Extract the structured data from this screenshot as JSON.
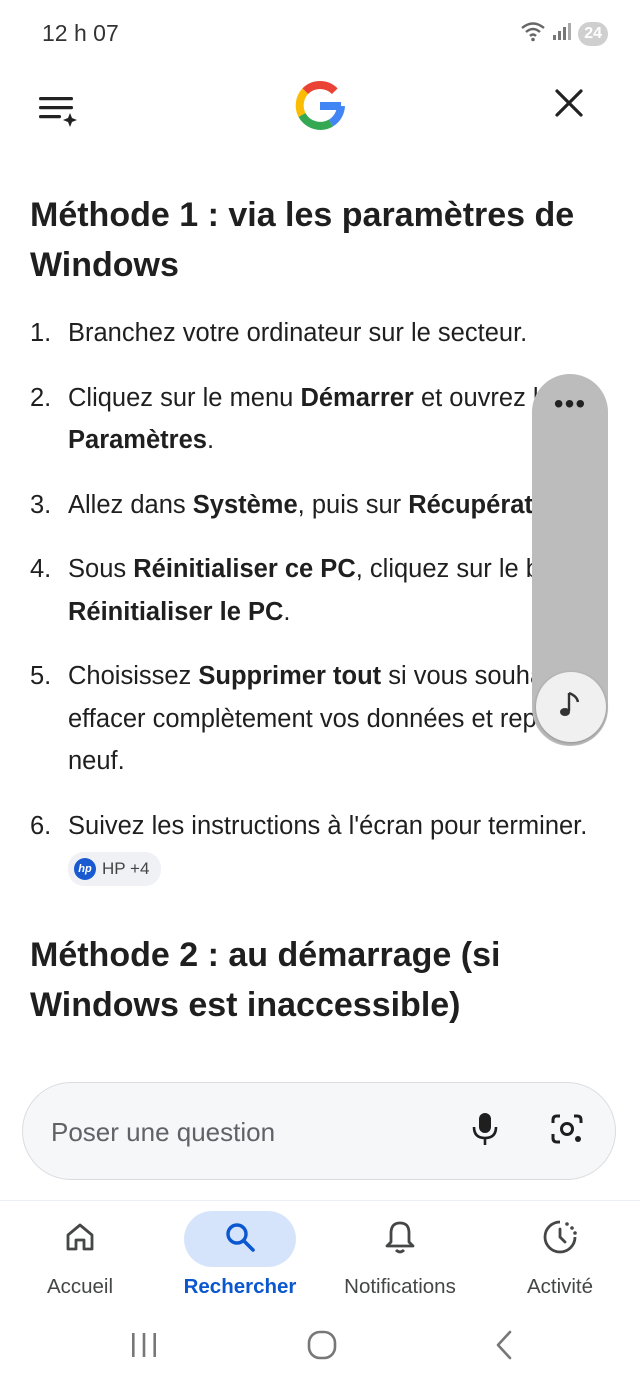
{
  "status_bar": {
    "time": "12 h 07",
    "battery_level": "24"
  },
  "header": {
    "menu_icon": "menu-sparkle-icon",
    "logo": "google-g-logo",
    "close_icon": "close-icon"
  },
  "article": {
    "heading1": "Méthode 1 : via les paramètres de Windows",
    "steps": [
      {
        "num": "1.",
        "parts": [
          {
            "t": "Branchez votre ordinateur sur le secteur."
          }
        ]
      },
      {
        "num": "2.",
        "parts": [
          {
            "t": "Cliquez sur le menu "
          },
          {
            "t": "Démarrer",
            "b": true
          },
          {
            "t": " et ouvrez les "
          },
          {
            "t": "Paramètres",
            "b": true
          },
          {
            "t": "."
          }
        ]
      },
      {
        "num": "3.",
        "parts": [
          {
            "t": "Allez dans "
          },
          {
            "t": "Système",
            "b": true
          },
          {
            "t": ", puis sur "
          },
          {
            "t": "Récupération",
            "b": true
          },
          {
            "t": "."
          }
        ]
      },
      {
        "num": "4.",
        "parts": [
          {
            "t": "Sous "
          },
          {
            "t": "Réinitialiser ce PC",
            "b": true
          },
          {
            "t": ", cliquez sur le bouton "
          },
          {
            "t": "Réinitialiser le PC",
            "b": true
          },
          {
            "t": "."
          }
        ]
      },
      {
        "num": "5.",
        "parts": [
          {
            "t": "Choisissez "
          },
          {
            "t": "Supprimer tout",
            "b": true
          },
          {
            "t": " si vous souhaitez effacer complètement vos données et repartir à neuf."
          }
        ]
      },
      {
        "num": "6.",
        "parts": [
          {
            "t": "Suivez les instructions à l'écran pour terminer. "
          }
        ]
      }
    ],
    "source_chip": {
      "logo_text": "hp",
      "label": "HP +4"
    },
    "heading2": "Méthode 2 : au démarrage (si Windows est inaccessible)"
  },
  "audio_panel": {
    "more_icon": "more-horiz-icon",
    "dots": "•••",
    "music_icon": "music-note-icon"
  },
  "search": {
    "placeholder": "Poser une question",
    "mic_icon": "microphone-icon",
    "lens_icon": "google-lens-icon"
  },
  "bottom_nav": [
    {
      "label": "Accueil",
      "icon": "home-icon",
      "active": false
    },
    {
      "label": "Rechercher",
      "icon": "search-icon",
      "active": true
    },
    {
      "label": "Notifications",
      "icon": "bell-icon",
      "active": false
    },
    {
      "label": "Activité",
      "icon": "activity-icon",
      "active": false
    }
  ],
  "system_nav": {
    "recents": "recents-icon",
    "home": "home-circle-icon",
    "back": "back-icon"
  },
  "colors": {
    "accent": "#0b57d0",
    "active_pill": "#d6e4fb",
    "text": "#1f1f1f",
    "muted": "#444746",
    "panel": "#bcbcbc"
  }
}
